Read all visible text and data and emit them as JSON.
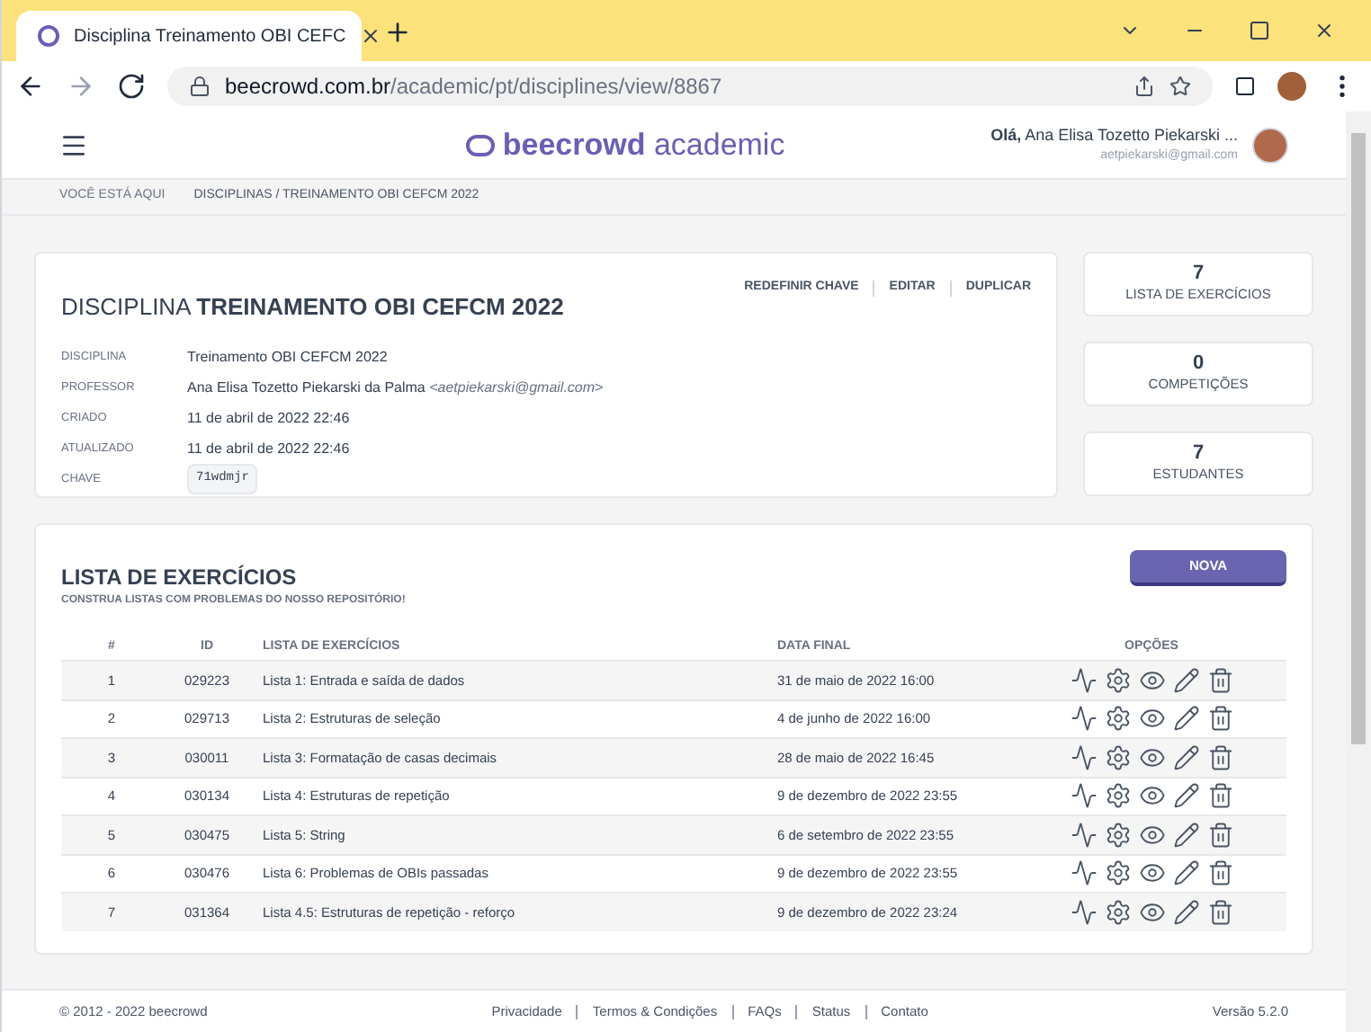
{
  "browser": {
    "tab_title": "Disciplina Treinamento OBI CEFC",
    "url_host": "beecrowd.com.br",
    "url_path": "/academic/pt/disciplines/view/8867"
  },
  "header": {
    "logo_bold": "beecrowd",
    "logo_light": "academic",
    "greeting": "Olá,",
    "user_name": "Ana Elisa Tozetto Piekarski ...",
    "user_email": "aetpiekarski@gmail.com"
  },
  "breadcrumb": {
    "label": "VOCÊ ESTÁ AQUI",
    "path": "DISCIPLINAS / TREINAMENTO OBI CEFCM 2022"
  },
  "discipline": {
    "title_prefix": "DISCIPLINA",
    "title": "TREINAMENTO OBI CEFCM 2022",
    "actions": [
      "REDEFINIR CHAVE",
      "EDITAR",
      "DUPLICAR"
    ],
    "fields": [
      {
        "kind": "text",
        "label": "DISCIPLINA",
        "value": "Treinamento OBI CEFCM 2022"
      },
      {
        "kind": "person",
        "label": "PROFESSOR",
        "value": "Ana Elisa Tozetto Piekarski da Palma",
        "email": "<aetpiekarski@gmail.com>"
      },
      {
        "kind": "text",
        "label": "CRIADO",
        "value": "11 de abril de 2022 22:46"
      },
      {
        "kind": "text",
        "label": "ATUALIZADO",
        "value": "11 de abril de 2022 22:46"
      },
      {
        "kind": "code",
        "label": "CHAVE",
        "value": "71wdmjr"
      }
    ]
  },
  "stats": [
    {
      "count": "7",
      "label": "LISTA DE EXERCÍCIOS"
    },
    {
      "count": "0",
      "label": "COMPETIÇÕES"
    },
    {
      "count": "7",
      "label": "ESTUDANTES"
    }
  ],
  "lists": {
    "title": "LISTA DE EXERCÍCIOS",
    "subtitle": "CONSTRUA LISTAS COM PROBLEMAS DO NOSSO REPOSITÓRIO!",
    "new_button": "NOVA",
    "columns": [
      "#",
      "ID",
      "LISTA DE EXERCÍCIOS",
      "DATA FINAL",
      "OPÇÕES"
    ],
    "rows": [
      {
        "num": "1",
        "id": "029223",
        "name": "Lista 1: Entrada e saída de dados",
        "deadline": "31 de maio de 2022 16:00"
      },
      {
        "num": "2",
        "id": "029713",
        "name": "Lista 2: Estruturas de seleção",
        "deadline": "4 de junho de 2022 16:00"
      },
      {
        "num": "3",
        "id": "030011",
        "name": "Lista 3: Formatação de casas decimais",
        "deadline": "28 de maio de 2022 16:45"
      },
      {
        "num": "4",
        "id": "030134",
        "name": "Lista 4: Estruturas de repetição",
        "deadline": "9 de dezembro de 2022 23:55"
      },
      {
        "num": "5",
        "id": "030475",
        "name": "Lista 5: String",
        "deadline": "6 de setembro de 2022 23:55"
      },
      {
        "num": "6",
        "id": "030476",
        "name": "Lista 6: Problemas de OBIs passadas",
        "deadline": "9 de dezembro de 2022 23:55"
      },
      {
        "num": "7",
        "id": "031364",
        "name": "Lista 4.5: Estruturas de repetição - reforço",
        "deadline": "9 de dezembro de 2022 23:24"
      }
    ]
  },
  "footer": {
    "copyright": "© 2012 - 2022 beecrowd",
    "links": [
      "Privacidade",
      "Termos & Condições",
      "FAQs",
      "Status",
      "Contato"
    ],
    "version": "Versão 5.2.0"
  }
}
